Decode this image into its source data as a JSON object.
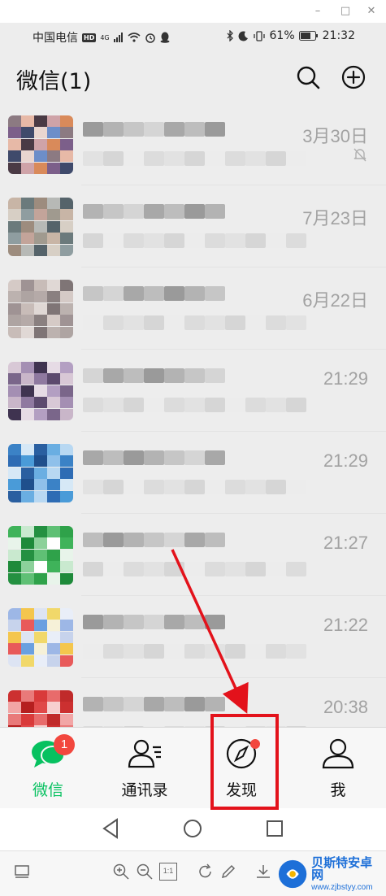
{
  "window": {
    "minimize_label": "–",
    "maximize_label": "□",
    "close_label": "✕"
  },
  "status_bar": {
    "carrier": "中国电信",
    "hd": "HD",
    "network": "4G",
    "battery_percent": "61%",
    "time": "21:32"
  },
  "header": {
    "title": "微信(1)",
    "search_icon": "search-icon",
    "add_icon": "plus-circle-icon"
  },
  "chats": [
    {
      "time": "3月30日",
      "muted": true
    },
    {
      "time": "7月23日",
      "muted": false
    },
    {
      "time": "6月22日",
      "muted": false
    },
    {
      "time": "21:29",
      "muted": false
    },
    {
      "time": "21:29",
      "muted": false
    },
    {
      "time": "21:27",
      "muted": false
    },
    {
      "time": "21:22",
      "muted": false
    },
    {
      "time": "20:38",
      "muted": false
    }
  ],
  "tabs": [
    {
      "label": "微信",
      "icon": "chat-bubble-icon",
      "badge": "1",
      "active": true
    },
    {
      "label": "通讯录",
      "icon": "contacts-icon",
      "active": false
    },
    {
      "label": "发现",
      "icon": "compass-icon",
      "dot": true,
      "active": false
    },
    {
      "label": "我",
      "icon": "person-icon",
      "active": false
    }
  ],
  "nav": {
    "back_icon": "triangle-back-icon",
    "home_icon": "circle-home-icon",
    "recent_icon": "square-recent-icon"
  },
  "viewer_toolbar": {
    "actual_size_label": "1:1"
  },
  "watermark": {
    "title": "贝斯特安卓网",
    "url": "www.zjbstyy.com"
  },
  "colors": {
    "accent_green": "#07c160",
    "badge_red": "#f2473e",
    "annotation_red": "#e3121b",
    "background": "#ededed"
  }
}
